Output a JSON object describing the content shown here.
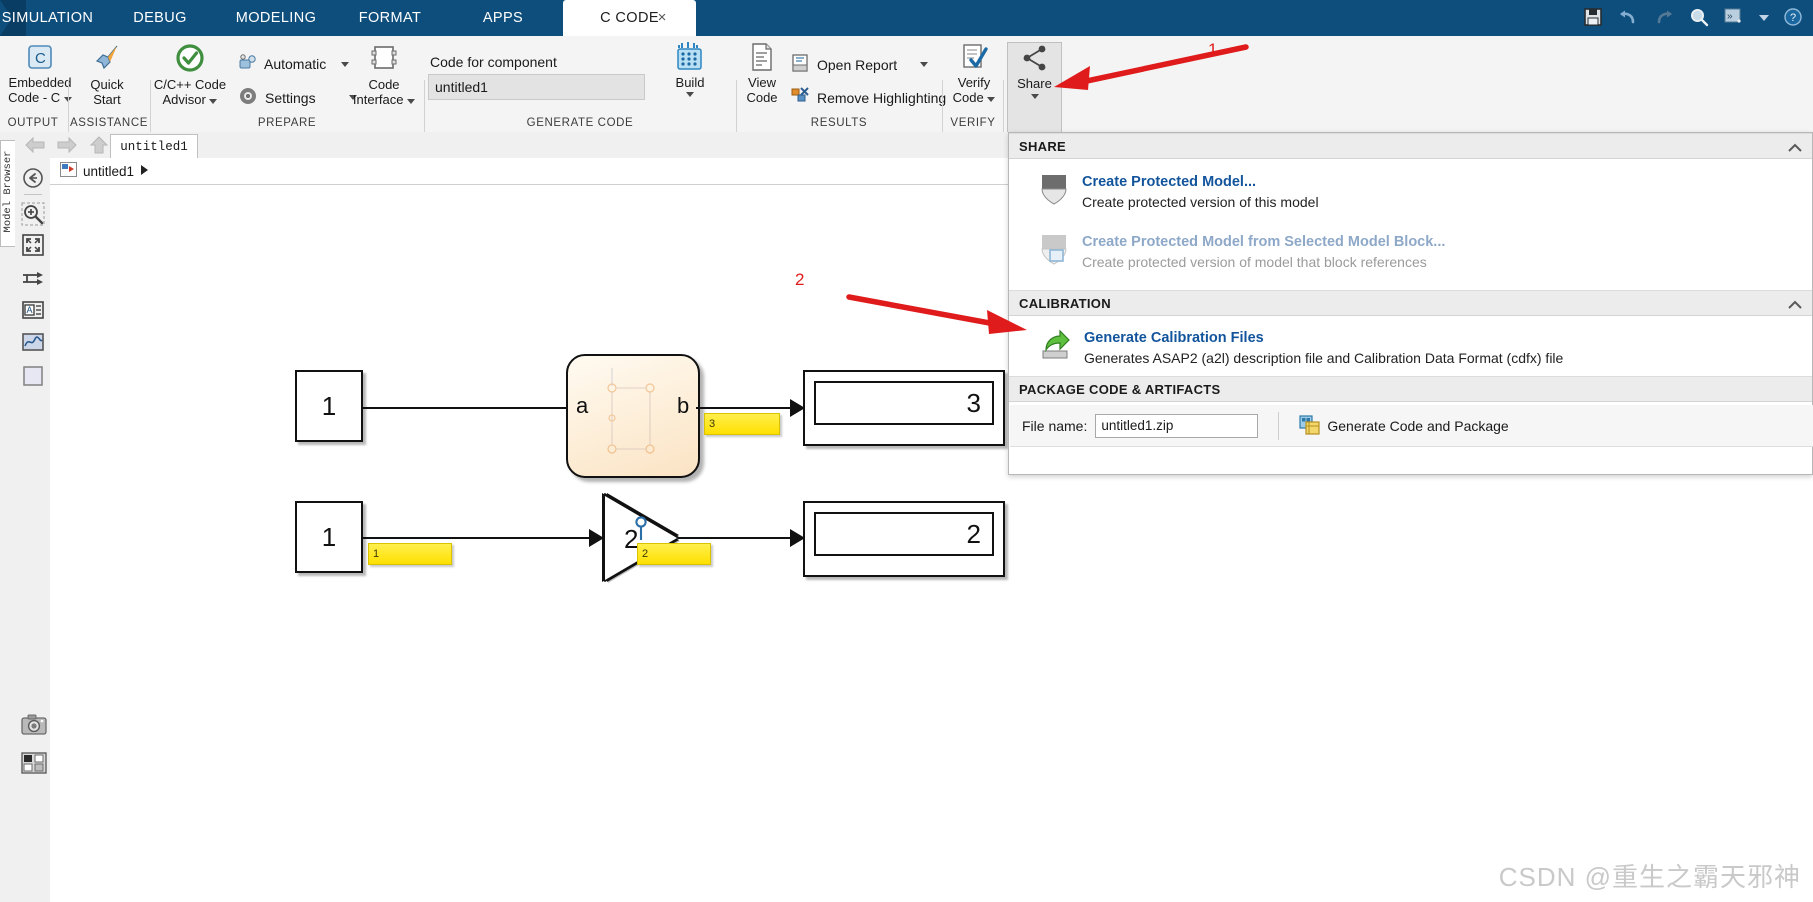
{
  "tabs": [
    {
      "label": "SIMULATION",
      "active": false
    },
    {
      "label": "DEBUG",
      "active": false
    },
    {
      "label": "MODELING",
      "active": false
    },
    {
      "label": "FORMAT",
      "active": false
    },
    {
      "label": "APPS",
      "active": false
    },
    {
      "label": "C CODE",
      "active": true
    }
  ],
  "tab_close_glyph": "×",
  "quick_access": [
    {
      "name": "save-icon",
      "glyph": "💾"
    },
    {
      "name": "undo-icon",
      "glyph": "↶"
    },
    {
      "name": "redo-icon",
      "glyph": "↷"
    },
    {
      "name": "search-icon",
      "glyph": "🔍"
    },
    {
      "name": "more-commands-icon",
      "glyph": "»"
    },
    {
      "name": "help-icon",
      "glyph": "?"
    }
  ],
  "ribbon": {
    "groups": [
      {
        "label": "OUTPUT"
      },
      {
        "label": "ASSISTANCE"
      },
      {
        "label": "PREPARE"
      },
      {
        "label": "GENERATE CODE"
      },
      {
        "label": "RESULTS"
      },
      {
        "label": "VERIFY"
      },
      {
        "label": "SHARE"
      }
    ],
    "embedded_code": {
      "line1": "Embedded",
      "line2": "Code - C"
    },
    "quick_start": {
      "line1": "Quick",
      "line2": "Start"
    },
    "code_advisor": {
      "line1": "C/C++ Code",
      "line2": "Advisor"
    },
    "automatic": "Automatic",
    "settings": "Settings",
    "code_interface": {
      "line1": "Code",
      "line2": "Interface"
    },
    "code_for_component_label": "Code for component",
    "code_for_component_value": "untitled1",
    "build": "Build",
    "view_code": {
      "line1": "View",
      "line2": "Code"
    },
    "open_report": "Open Report",
    "remove_highlighting": "Remove Highlighting",
    "verify_code": {
      "line1": "Verify",
      "line2": "Code"
    },
    "share": "Share"
  },
  "model_browser_label": "Model Browser",
  "file_tab": "untitled1",
  "breadcrumb": "untitled1",
  "rail_icons": [
    {
      "name": "back-to-parent-icon"
    },
    {
      "name": "zoom-in-icon"
    },
    {
      "name": "fit-to-view-icon"
    },
    {
      "name": "signal-routing-icon"
    },
    {
      "name": "annotation-icon"
    },
    {
      "name": "scope-viewer-icon"
    },
    {
      "name": "block-placeholder-icon"
    },
    {
      "name": "snapshot-camera-icon"
    },
    {
      "name": "legend-icon"
    }
  ],
  "canvas": {
    "blocks": [
      {
        "name": "inport-1-top",
        "type": "inport",
        "label": "1"
      },
      {
        "name": "stateflow-chart",
        "type": "chart",
        "in_port": "a",
        "out_port": "b"
      },
      {
        "name": "outport-3",
        "type": "outport",
        "label": "3"
      },
      {
        "name": "inport-1-bottom",
        "type": "inport",
        "label": "1"
      },
      {
        "name": "gain-block",
        "type": "gain",
        "label": "2"
      },
      {
        "name": "outport-2",
        "type": "outport",
        "label": "2"
      }
    ],
    "signal_labels": [
      {
        "name": "signal-label-3",
        "value": "3"
      },
      {
        "name": "signal-label-1",
        "value": "1"
      },
      {
        "name": "signal-label-2",
        "value": "2"
      }
    ]
  },
  "share_panel": {
    "sections": [
      {
        "header": "SHARE",
        "items": [
          {
            "icon": "shield-icon",
            "title": "Create Protected Model...",
            "desc": "Create protected version of this model",
            "disabled": false
          },
          {
            "icon": "shield-block-icon",
            "title": "Create Protected Model from Selected Model Block...",
            "desc": "Create protected version of model that block references",
            "disabled": true
          }
        ]
      },
      {
        "header": "CALIBRATION",
        "items": [
          {
            "icon": "export-arrow-icon",
            "title": "Generate Calibration Files",
            "desc": "Generates ASAP2 (a2l) description file and Calibration Data Format (cdfx) file",
            "disabled": false
          }
        ]
      },
      {
        "header": "PACKAGE CODE & ARTIFACTS",
        "items": []
      }
    ],
    "file_name_label": "File name:",
    "file_name_value": "untitled1.zip",
    "generate_package_label": "Generate Code and Package",
    "generate_package_icon": "package-icon"
  },
  "annotations": [
    {
      "name": "annotation-1",
      "label": "1"
    },
    {
      "name": "annotation-2",
      "label": "2"
    }
  ],
  "watermark": "CSDN @重生之霸天邪神",
  "colors": {
    "tabbar_blue": "#0e4e7d",
    "link_blue": "#12549c",
    "annotation_red": "#e01b1b",
    "signal_label_yellow": "#ffe81a",
    "chart_fill": "#fdf0dc"
  }
}
